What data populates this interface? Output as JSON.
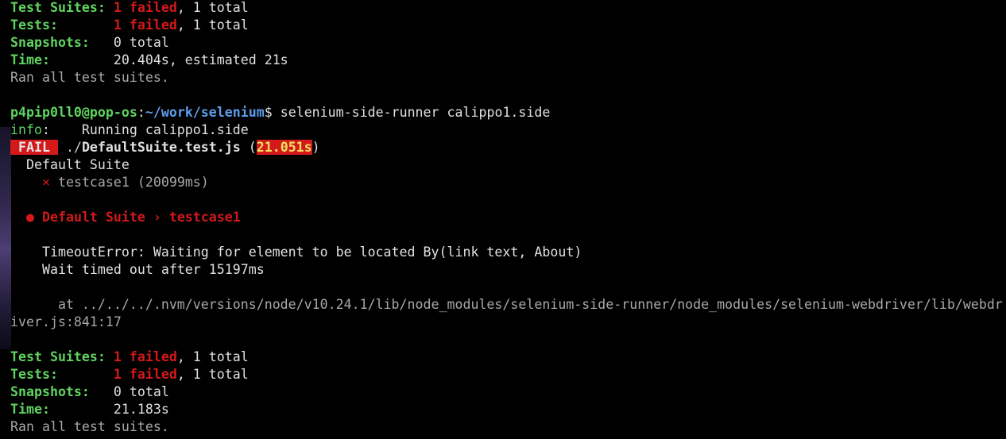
{
  "summary1": {
    "suites_label": "Test Suites:",
    "suites_failed": "1 failed",
    "suites_rest": ", 1 total",
    "tests_label": "Tests:",
    "tests_failed": "1 failed",
    "tests_rest": ", 1 total",
    "snapshots_label": "Snapshots:",
    "snapshots_value": "0 total",
    "time_label": "Time:",
    "time_value": "20.404s, estimated 21s",
    "ran": "Ran all test suites."
  },
  "prompt": {
    "user_host": "p4pip0ll0@pop-os",
    "sep": ":",
    "path": "~/work/selenium",
    "symbol": "$",
    "command": "selenium-side-runner calippo1.side"
  },
  "info": {
    "tag": "info",
    "message": "Running calippo1.side"
  },
  "result": {
    "badge": " FAIL ",
    "dir": "./",
    "file": "DefaultSuite.test.js",
    "open": " (",
    "duration": "21.051s",
    "close": ")"
  },
  "suite": {
    "name": "Default Suite",
    "cross": "×",
    "test": "testcase1 (20099ms)"
  },
  "error": {
    "bullet": "●",
    "title": "Default Suite › testcase1",
    "message1": "TimeoutError: Waiting for element to be located By(link text, About)",
    "message2": "Wait timed out after 15197ms",
    "stack1": "at ../../../.nvm/versions/node/v10.24.1/lib/node_modules/selenium-side-runner/node_modules/selenium-webdriver/lib/webdr",
    "stack2": "iver.js:841:17"
  },
  "summary2": {
    "suites_label": "Test Suites:",
    "suites_failed": "1 failed",
    "suites_rest": ", 1 total",
    "tests_label": "Tests:",
    "tests_failed": "1 failed",
    "tests_rest": ", 1 total",
    "snapshots_label": "Snapshots:",
    "snapshots_value": "0 total",
    "time_label": "Time:",
    "time_value": "21.183s",
    "ran": "Ran all test suites."
  },
  "colors": {
    "background": "#000000",
    "green": "#5fd35f",
    "red": "#d3191a",
    "blue": "#5c9eea",
    "text": "#e0e0e0"
  }
}
